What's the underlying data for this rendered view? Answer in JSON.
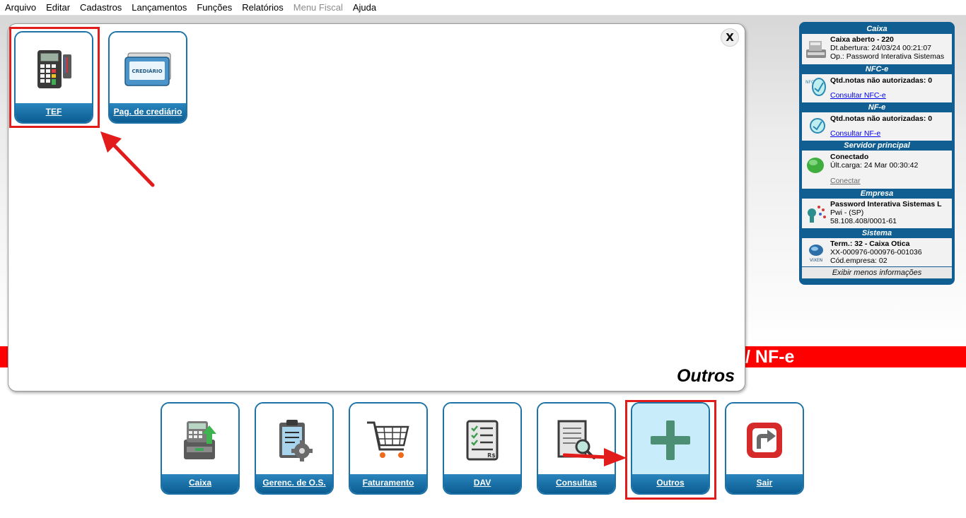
{
  "menu": {
    "items": [
      {
        "label": "Arquivo"
      },
      {
        "label": "Editar"
      },
      {
        "label": "Cadastros"
      },
      {
        "label": "Lançamentos"
      },
      {
        "label": "Funções"
      },
      {
        "label": "Relatórios"
      },
      {
        "label": "Menu Fiscal"
      },
      {
        "label": "Ajuda"
      }
    ]
  },
  "banner": {
    "text": "/ NF-e",
    "color": "#ff0000"
  },
  "panel": {
    "title": "Outros",
    "close_label": "X",
    "tiles": [
      {
        "label": "TEF",
        "icon": "card-terminal-icon"
      },
      {
        "label": "Pag. de crediário",
        "icon": "crediario-card-icon",
        "card_text": "CREDIÁRIO"
      }
    ]
  },
  "bottom_bar": {
    "tiles": [
      {
        "label": "Caixa",
        "icon": "cash-register-icon"
      },
      {
        "label": "Gerenc. de O.S.",
        "icon": "clipboard-gear-icon"
      },
      {
        "label": "Faturamento",
        "icon": "shopping-cart-icon"
      },
      {
        "label": "DAV",
        "icon": "checklist-icon",
        "badge": "R$"
      },
      {
        "label": "Consultas",
        "icon": "document-search-icon"
      },
      {
        "label": "Outros",
        "icon": "plus-icon",
        "selected": true
      },
      {
        "label": "Sair",
        "icon": "exit-icon"
      }
    ]
  },
  "info": {
    "caixa": {
      "header": "Caixa",
      "status": "Caixa aberto - 220",
      "opening": "Dt.abertura: 24/03/24 00:21:07",
      "operator": "Op.: Password Interativa Sistemas"
    },
    "nfce": {
      "header": "NFC-e",
      "pending": "Qtd.notas não autorizadas: 0",
      "link": "Consultar NFC-e"
    },
    "nfe": {
      "header": "NF-e",
      "pending": "Qtd.notas não autorizadas: 0",
      "link": "Consultar NF-e"
    },
    "server": {
      "header": "Servidor principal",
      "status": "Conectado",
      "last_load": "Últ.carga: 24 Mar 00:30:42",
      "link": "Conectar"
    },
    "empresa": {
      "header": "Empresa",
      "name": "Password Interativa Sistemas L",
      "location": "Pwi - (SP)",
      "cnpj": "58.108.408/0001-61"
    },
    "sistema": {
      "header": "Sistema",
      "terminal": "Term.: 32 - Caixa Otica",
      "serial": "XX-000976-000976-001036",
      "company_code": "Cód.empresa: 02",
      "logo_text": "VIXEN"
    },
    "footer": "Exibir menos informações"
  },
  "colors": {
    "tile_blue": "#0b5d92",
    "highlight_red": "#e21b1b",
    "selected_bg": "#c9ecfa",
    "plus_green": "#4d8f74"
  }
}
